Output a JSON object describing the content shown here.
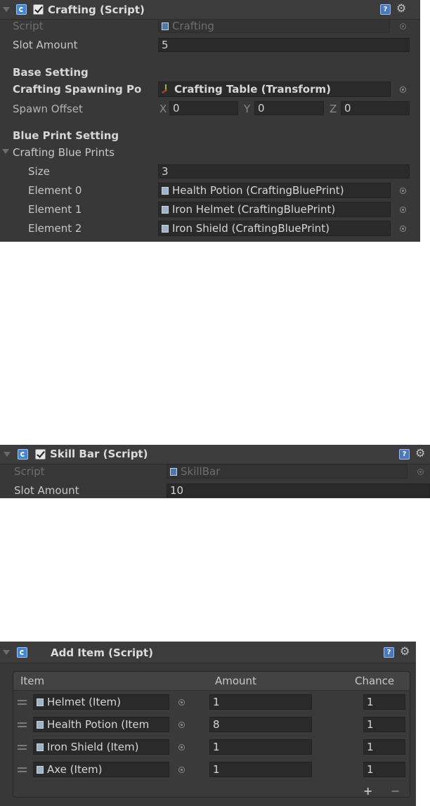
{
  "crafting": {
    "title": "Crafting (Script)",
    "script_label": "Script",
    "script_value": "Crafting",
    "slot_amount_label": "Slot Amount",
    "slot_amount_value": "5",
    "base_setting_header": "Base Setting",
    "spawning_point_label": "Crafting Spawning Po",
    "spawning_point_value": "Crafting Table (Transform)",
    "spawn_offset_label": "Spawn Offset",
    "offset": {
      "x_label": "X",
      "x": "0",
      "y_label": "Y",
      "y": "0",
      "z_label": "Z",
      "z": "0"
    },
    "blueprint_header": "Blue Print Setting",
    "blueprints_label": "Crafting Blue Prints",
    "size_label": "Size",
    "size_value": "3",
    "elements": [
      {
        "label": "Element 0",
        "value": "Health Potion (CraftingBluePrint)"
      },
      {
        "label": "Element 1",
        "value": "Iron Helmet (CraftingBluePrint)"
      },
      {
        "label": "Element 2",
        "value": "Iron Shield (CraftingBluePrint)"
      }
    ]
  },
  "skillbar": {
    "title": "Skill Bar (Script)",
    "script_label": "Script",
    "script_value": "SkillBar",
    "slot_amount_label": "Slot Amount",
    "slot_amount_value": "10"
  },
  "additem": {
    "title": "Add Item (Script)",
    "columns": [
      "Item",
      "Amount",
      "Chance"
    ],
    "rows": [
      {
        "item": "Helmet (Item)",
        "amount": "1",
        "chance": "1"
      },
      {
        "item": "Health Potion (Item",
        "amount": "8",
        "chance": "1"
      },
      {
        "item": "Iron Shield (Item)",
        "amount": "1",
        "chance": "1"
      },
      {
        "item": "Axe (Item)",
        "amount": "1",
        "chance": "1"
      }
    ],
    "plus_label": "+",
    "minus_label": "−"
  },
  "icons": {
    "help": "?",
    "gear": "⚙"
  },
  "colors": {
    "panel": "#383838",
    "field": "#2a2a2a",
    "accent": "#3f86d6"
  }
}
